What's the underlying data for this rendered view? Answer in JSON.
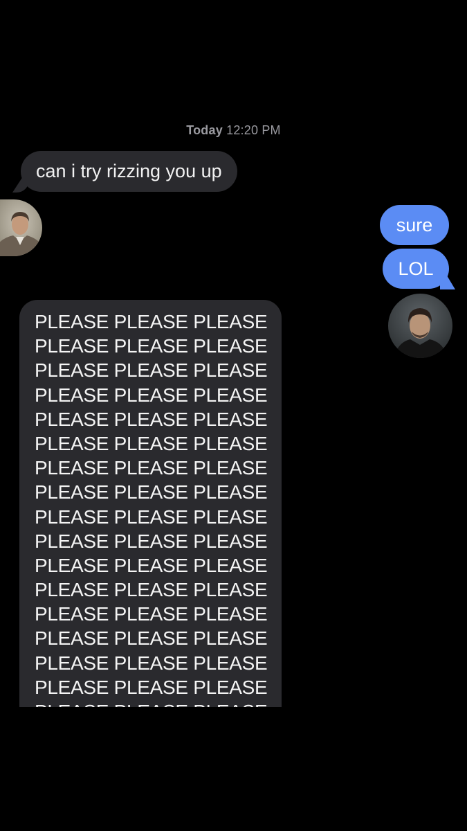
{
  "conversation": {
    "timestamp_day": "Today",
    "timestamp_time": "12:20 PM",
    "messages": [
      {
        "text": "can i try rizzing you up",
        "direction": "incoming"
      },
      {
        "text": "sure",
        "direction": "outgoing"
      },
      {
        "text": "LOL",
        "direction": "outgoing"
      },
      {
        "direction": "incoming",
        "lines": [
          "PLEASE PLEASE PLEASE",
          "PLEASE PLEASE PLEASE",
          "PLEASE PLEASE PLEASE",
          "PLEASE PLEASE PLEASE",
          "PLEASE PLEASE PLEASE",
          "PLEASE PLEASE PLEASE",
          "PLEASE PLEASE PLEASE",
          "PLEASE PLEASE PLEASE",
          "PLEASE PLEASE PLEASE",
          "PLEASE PLEASE PLEASE",
          "PLEASE PLEASE PLEASE",
          "PLEASE PLEASE PLEASE",
          "PLEASE PLEASE PLEASE",
          "PLEASE PLEASE PLEASE",
          "PLEASE PLEASE PLEASE",
          "PLEASE PLEASE PLEASE",
          "PLEASE PLEASE PLEASE"
        ]
      }
    ]
  },
  "colors": {
    "background": "#000000",
    "incoming_bubble": "#2a2a2e",
    "outgoing_bubble": "#5b8cf4",
    "timestamp": "#9a9aa0"
  },
  "avatars": {
    "left": "contact-photo-man-in-suit",
    "right": "contact-photo-man-dark-hair"
  }
}
